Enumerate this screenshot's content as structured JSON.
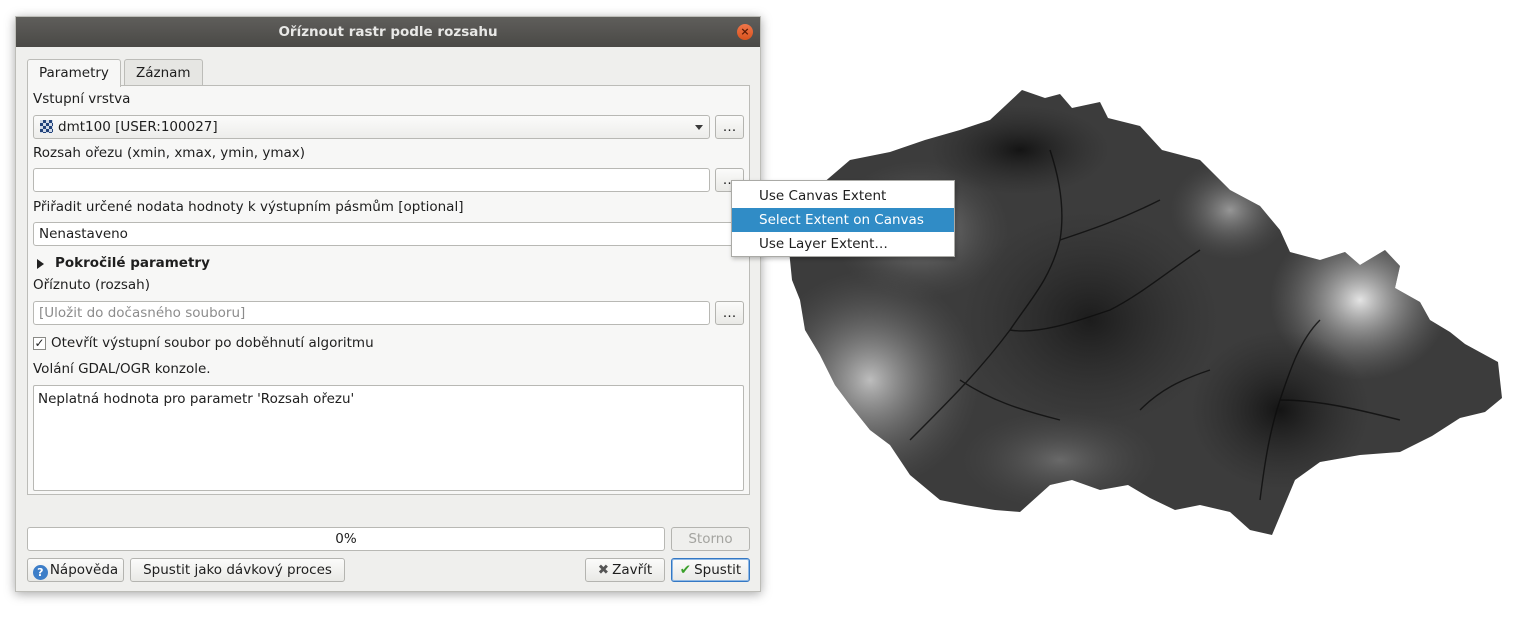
{
  "window": {
    "title": "Oříznout rastr podle rozsahu",
    "close_symbol": "×"
  },
  "tabs": [
    {
      "label": "Parametry",
      "active": true
    },
    {
      "label": "Záznam",
      "active": false
    }
  ],
  "params": {
    "input_layer_label": "Vstupní vrstva",
    "input_layer_value": "dmt100 [USER:100027]",
    "input_layer_icon": "raster-layer-icon",
    "extent_label": "Rozsah ořezu (xmin, xmax, ymin, ymax)",
    "extent_value": "",
    "nodata_label": "Přiřadit určené nodata hodnoty k výstupním pásmům [optional]",
    "nodata_value": "Nenastaveno",
    "advanced_label": "Pokročilé parametry",
    "output_label": "Oříznuto (rozsah)",
    "output_placeholder": "[Uložit do dočasného souboru]",
    "open_output_checked": true,
    "open_output_label": "Otevřít výstupní soubor po doběhnutí algoritmu",
    "console_label": "Volání GDAL/OGR konzole.",
    "console_text": "Neplatná hodnota pro parametr 'Rozsah ořezu'",
    "browse_button": "…"
  },
  "progress": {
    "text": "0%",
    "value": 0
  },
  "buttons": {
    "cancel": "Storno",
    "help": "Nápověda",
    "batch": "Spustit jako dávkový proces",
    "close": "Zavřít",
    "run": "Spustit"
  },
  "extent_menu": {
    "items": [
      {
        "label": "Use Canvas Extent",
        "selected": false
      },
      {
        "label": "Select Extent on Canvas",
        "selected": true
      },
      {
        "label": "Use Layer Extent…",
        "selected": false
      }
    ]
  },
  "colors": {
    "menu_highlight": "#308cc6",
    "titlebar": "#4f4e4b",
    "close_button": "#e2612f"
  }
}
